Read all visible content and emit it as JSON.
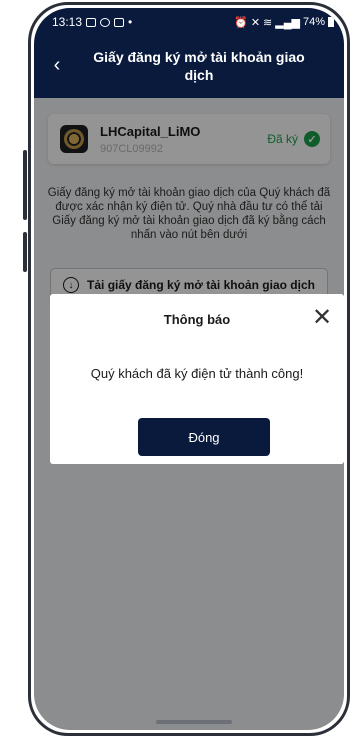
{
  "status_bar": {
    "time": "13:13",
    "right_text": "74%",
    "icons": [
      "image-icon",
      "messenger-icon",
      "video-icon",
      "alarm-icon",
      "mute-icon",
      "wifi-icon",
      "volte-icon",
      "signal-icon",
      "battery-icon"
    ]
  },
  "header": {
    "title": "Giấy đăng ký mở tài khoản giao dịch",
    "back_icon": "chevron-left-icon"
  },
  "account": {
    "name": "LHCapital_LiMO",
    "id": "907CL09992",
    "status": "Đã ký"
  },
  "description": "Giấy đăng ký mở tài khoản giao dịch của Quý khách đã được xác nhận ký điện tử. Quý nhà đầu tư có thể tải Giấy đăng ký mở tài khoản giao dịch đã ký bằng cách nhấn vào nút bên dưới",
  "download_label": "Tải giấy đăng ký mở tài khoản giao dịch",
  "modal": {
    "title": "Thông báo",
    "message": "Quý khách đã ký điện tử thành công!",
    "button_label": "Đóng"
  },
  "colors": {
    "primary": "#0a1a3d",
    "success": "#1aa14a"
  }
}
